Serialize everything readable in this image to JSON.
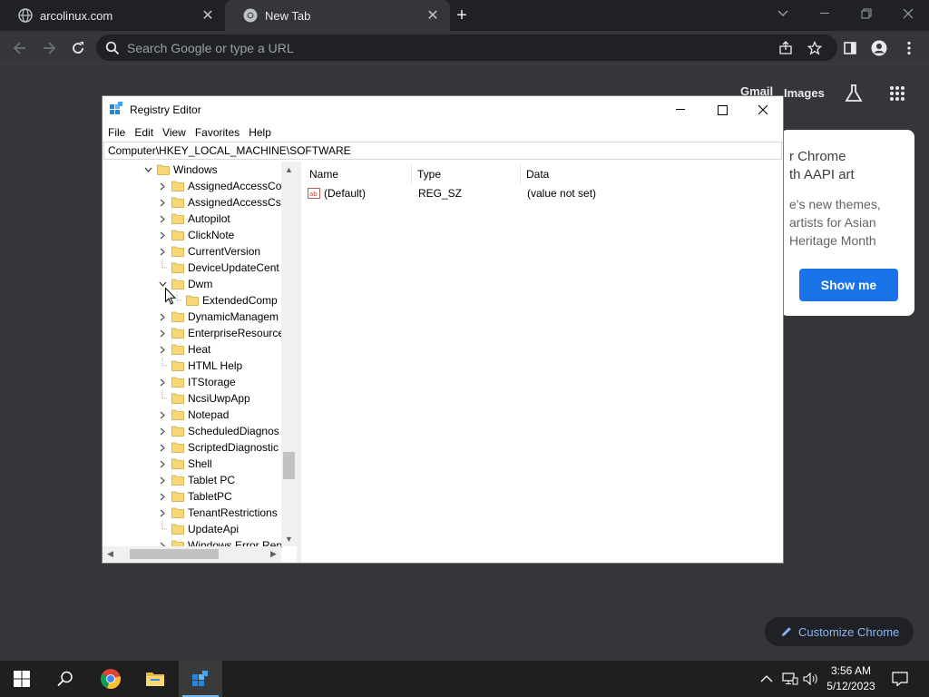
{
  "browser": {
    "tabs": [
      {
        "title": "arcolinux.com",
        "active": false,
        "icon": "globe-icon"
      },
      {
        "title": "New Tab",
        "active": true,
        "icon": "chrome-icon"
      }
    ],
    "new_tab_label": "+",
    "omnibox": {
      "placeholder": "Search Google or type a URL",
      "value": ""
    },
    "window_controls": [
      "minimize",
      "restore",
      "close"
    ]
  },
  "ntp": {
    "links": {
      "gmail": "Gmail",
      "images": "Images"
    },
    "promo": {
      "title": "r Chrome\nth AAPI art",
      "body": "e's new themes,\nartists for Asian\nHeritage Month",
      "button": "Show me"
    },
    "customize_label": "Customize Chrome"
  },
  "regedit": {
    "title": "Registry Editor",
    "menu": [
      "File",
      "Edit",
      "View",
      "Favorites",
      "Help"
    ],
    "address": "Computer\\HKEY_LOCAL_MACHINE\\SOFTWARE",
    "tree": [
      {
        "label": "Windows",
        "depth": 0,
        "expander": "expanded"
      },
      {
        "label": "AssignedAccessCo",
        "depth": 1,
        "expander": "collapsed"
      },
      {
        "label": "AssignedAccessCsp",
        "depth": 1,
        "expander": "collapsed"
      },
      {
        "label": "Autopilot",
        "depth": 1,
        "expander": "collapsed"
      },
      {
        "label": "ClickNote",
        "depth": 1,
        "expander": "collapsed"
      },
      {
        "label": "CurrentVersion",
        "depth": 1,
        "expander": "collapsed"
      },
      {
        "label": "DeviceUpdateCent",
        "depth": 1,
        "expander": "none"
      },
      {
        "label": "Dwm",
        "depth": 1,
        "expander": "expanded"
      },
      {
        "label": "ExtendedComp",
        "depth": 2,
        "expander": "none"
      },
      {
        "label": "DynamicManagem",
        "depth": 1,
        "expander": "collapsed"
      },
      {
        "label": "EnterpriseResource",
        "depth": 1,
        "expander": "collapsed"
      },
      {
        "label": "Heat",
        "depth": 1,
        "expander": "collapsed"
      },
      {
        "label": "HTML Help",
        "depth": 1,
        "expander": "none"
      },
      {
        "label": "ITStorage",
        "depth": 1,
        "expander": "collapsed"
      },
      {
        "label": "NcsiUwpApp",
        "depth": 1,
        "expander": "none"
      },
      {
        "label": "Notepad",
        "depth": 1,
        "expander": "collapsed"
      },
      {
        "label": "ScheduledDiagnos",
        "depth": 1,
        "expander": "collapsed"
      },
      {
        "label": "ScriptedDiagnostic",
        "depth": 1,
        "expander": "collapsed"
      },
      {
        "label": "Shell",
        "depth": 1,
        "expander": "collapsed"
      },
      {
        "label": "Tablet PC",
        "depth": 1,
        "expander": "collapsed"
      },
      {
        "label": "TabletPC",
        "depth": 1,
        "expander": "collapsed"
      },
      {
        "label": "TenantRestrictions",
        "depth": 1,
        "expander": "collapsed"
      },
      {
        "label": "UpdateApi",
        "depth": 1,
        "expander": "none"
      },
      {
        "label": "Windows Error Rep",
        "depth": 1,
        "expander": "collapsed"
      }
    ],
    "columns": {
      "name": "Name",
      "type": "Type",
      "data": "Data"
    },
    "values": [
      {
        "name": "(Default)",
        "type": "REG_SZ",
        "data": "(value not set)",
        "icon": "string-value-icon"
      }
    ]
  },
  "taskbar": {
    "pinned": [
      "start-button",
      "search-button",
      "chrome",
      "file-explorer",
      "registry-editor"
    ],
    "clock": {
      "time": "3:56 AM",
      "date": "5/12/2023"
    }
  },
  "colors": {
    "chrome_bg": "#35363a",
    "tabstrip": "#202124",
    "accent_blue": "#1a73e8",
    "link_blue": "#8ab4f8",
    "folder_yellow": "#f8d775"
  }
}
